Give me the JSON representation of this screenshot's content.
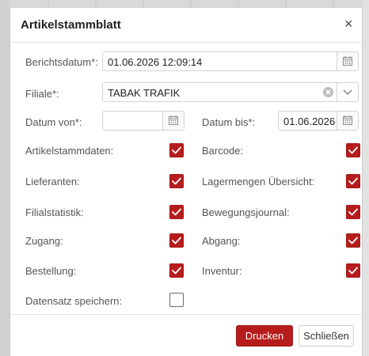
{
  "dialog": {
    "title": "Artikelstammblatt",
    "close_glyph": "×"
  },
  "form": {
    "berichtsdatum": {
      "label": "Berichtsdatum*:",
      "value": "01.06.2026 12:09:14",
      "icon": "calendar-icon"
    },
    "filiale": {
      "label": "Filiale*:",
      "value": "TABAK TRAFIK",
      "clear_icon": "clear-icon",
      "dropdown_icon": "chevron-down-icon"
    },
    "datum_von": {
      "label": "Datum von*:",
      "value": "",
      "icon": "calendar-icon"
    },
    "datum_bis": {
      "label": "Datum bis*:",
      "value": "01.06.2026",
      "icon": "calendar-icon"
    }
  },
  "options": [
    {
      "label": "Artikelstammdaten:",
      "checked": true
    },
    {
      "label": "Barcode:",
      "checked": true
    },
    {
      "label": "Lieferanten:",
      "checked": true
    },
    {
      "label": "Lagermengen Übersicht:",
      "checked": true
    },
    {
      "label": "Filialstatistik:",
      "checked": true
    },
    {
      "label": "Bewegungsjournal:",
      "checked": true
    },
    {
      "label": "Zugang:",
      "checked": true
    },
    {
      "label": "Abgang:",
      "checked": true
    },
    {
      "label": "Bestellung:",
      "checked": true
    },
    {
      "label": "Inventur:",
      "checked": true
    },
    {
      "label": "Datensatz speichern:",
      "checked": false
    }
  ],
  "footer": {
    "print_label": "Drucken",
    "close_label": "Schließen"
  },
  "colors": {
    "accent": "#b71c1c"
  }
}
